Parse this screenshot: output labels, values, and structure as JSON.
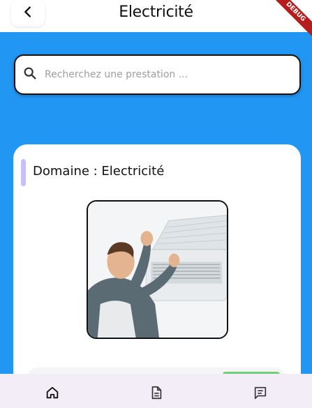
{
  "appbar": {
    "title": "Electricité",
    "back_icon": "chevron-left-icon",
    "debug_banner": "DEBUG"
  },
  "search": {
    "placeholder": "Recherchez une prestation ...",
    "value": "",
    "icon": "search-icon"
  },
  "domain_card": {
    "label": "Domaine : Electricité",
    "accent_color": "#C5C1FF",
    "image_icon": "technician-air-conditioner-photo"
  },
  "bottom_nav": {
    "items": [
      {
        "icon": "home-icon"
      },
      {
        "icon": "document-icon"
      },
      {
        "icon": "chat-icon"
      }
    ]
  },
  "colors": {
    "background": "#2196F3",
    "card": "#ffffff",
    "nav_background": "#F3EDF7",
    "service_badge": "#6FCF7A"
  }
}
